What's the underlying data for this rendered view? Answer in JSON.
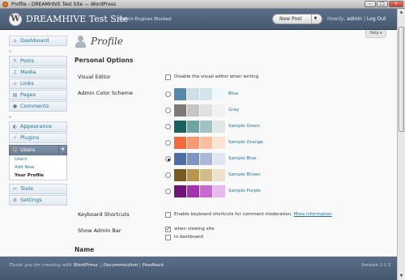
{
  "window": {
    "title": "Profile ‹ DREAMHIVE Test Site — WordPress",
    "controls": [
      "–",
      "□",
      "×"
    ]
  },
  "header": {
    "logo_text": "W",
    "site_title": "DREAMHIVE Test Site",
    "site_note": "Search Engines Blocked",
    "new_post": "New Post",
    "howdy": "Howdy, ",
    "username": "admin",
    "separator": " | ",
    "logout": "Log Out",
    "help": "Help ▾"
  },
  "menu": {
    "dashboard": "Dashboard",
    "posts": "Posts",
    "media": "Media",
    "links": "Links",
    "pages": "Pages",
    "comments": "Comments",
    "appearance": "Appearance",
    "plugins": "Plugins",
    "users": "Users",
    "users_sub": [
      "Users",
      "Add New",
      "Your Profile"
    ],
    "tools": "Tools",
    "settings": "Settings"
  },
  "page": {
    "title": "Profile",
    "section": "Personal Options",
    "visual_editor_label": "Visual Editor",
    "visual_editor_text": "Disable the visual editor when writing",
    "color_scheme_label": "Admin Color Scheme",
    "shortcuts_label": "Keyboard Shortcuts",
    "shortcuts_text": "Enable keyboard shortcuts for comment moderation.",
    "shortcuts_link": "More information",
    "admin_bar_label": "Show Admin Bar",
    "admin_bar_opt1": "when viewing site",
    "admin_bar_opt2": "in dashboard",
    "name_heading": "Name"
  },
  "color_schemes": [
    {
      "name": "Blue",
      "selected": false,
      "colors": [
        "#5589aa",
        "#cfdfe9",
        "#d1e5ee",
        "#eff8ff"
      ]
    },
    {
      "name": "Gray",
      "selected": false,
      "colors": [
        "#7c7976",
        "#c6c6c6",
        "#e0e0e0",
        "#f1f1f1"
      ]
    },
    {
      "name": "Sample Green",
      "selected": false,
      "colors": [
        "#1b6160",
        "#6fa4a2",
        "#a0c3c1",
        "#dde8e7"
      ]
    },
    {
      "name": "Sample Orange",
      "selected": false,
      "colors": [
        "#f4693a",
        "#f89972",
        "#fbbfa0",
        "#fce3d4"
      ]
    },
    {
      "name": "Sample Blue",
      "selected": true,
      "colors": [
        "#4e6ea8",
        "#7e95c3",
        "#a9b8d8",
        "#dfe5f1"
      ]
    },
    {
      "name": "Sample Brown",
      "selected": false,
      "colors": [
        "#7a5a22",
        "#b8964e",
        "#d2bc85",
        "#ede2c9"
      ]
    },
    {
      "name": "Sample Purple",
      "selected": false,
      "colors": [
        "#6f1579",
        "#a632b0",
        "#cc68d3",
        "#e9b8ee"
      ]
    }
  ],
  "footer": {
    "thanks": "Thank you for creating with ",
    "wordpress": "WordPress",
    "sep1": ". | ",
    "documentation": "Documentation",
    "sep2": " | ",
    "feedback": "Feedback",
    "version": "Version 3.1.2"
  },
  "scrollbar": {
    "up": "▲",
    "down": "▼"
  }
}
